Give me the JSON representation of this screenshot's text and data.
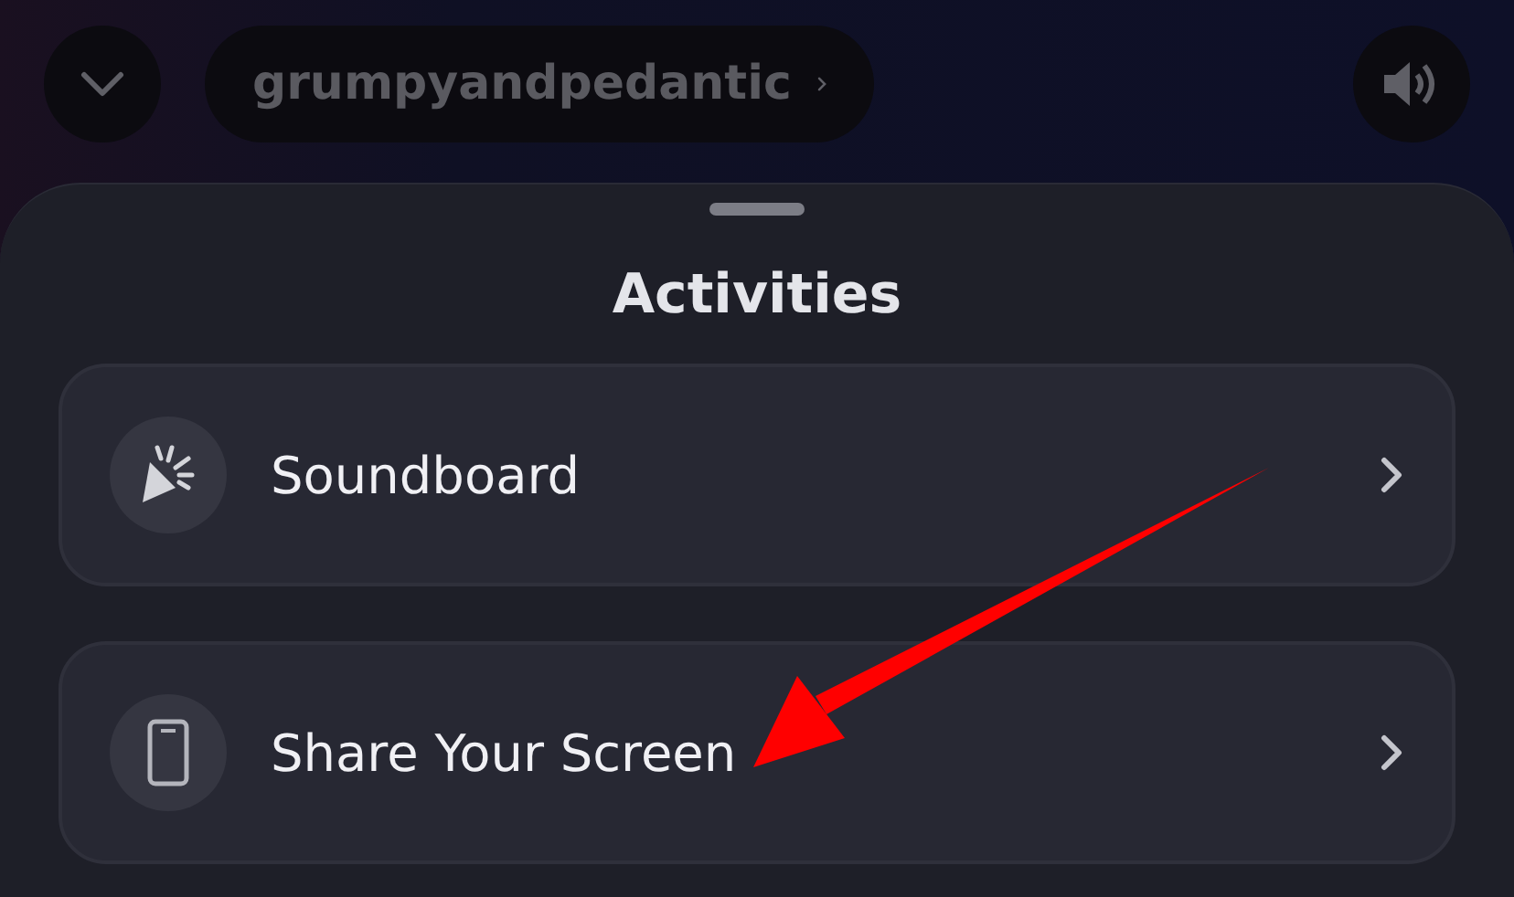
{
  "header": {
    "username": "grumpyandpedantic"
  },
  "sheet": {
    "title": "Activities",
    "items": [
      {
        "kind": "soundboard",
        "label": "Soundboard"
      },
      {
        "kind": "screen",
        "label": "Share Your Screen"
      }
    ]
  }
}
